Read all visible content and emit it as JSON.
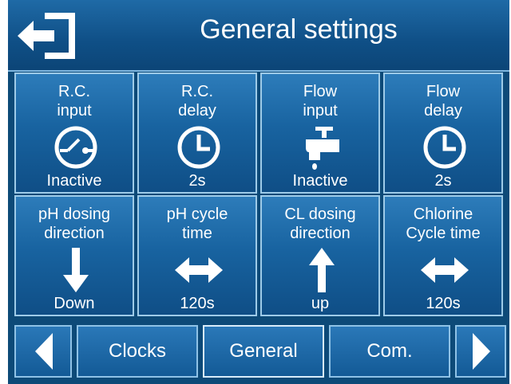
{
  "header": {
    "title": "General settings",
    "back_icon": "exit-arrow-icon"
  },
  "tiles": [
    {
      "label": "R.C.\ninput",
      "value": "Inactive",
      "icon": "switch-icon"
    },
    {
      "label": "R.C.\ndelay",
      "value": "2s",
      "icon": "clock-icon"
    },
    {
      "label": "Flow\ninput",
      "value": "Inactive",
      "icon": "faucet-icon"
    },
    {
      "label": "Flow\ndelay",
      "value": "2s",
      "icon": "clock-icon"
    },
    {
      "label": "pH dosing\ndirection",
      "value": "Down",
      "icon": "arrow-down-icon"
    },
    {
      "label": "pH cycle\ntime",
      "value": "120s",
      "icon": "double-arrow-icon"
    },
    {
      "label": "CL dosing\ndirection",
      "value": "up",
      "icon": "arrow-up-icon"
    },
    {
      "label": "Chlorine\nCycle time",
      "value": "120s",
      "icon": "double-arrow-icon"
    }
  ],
  "footer": {
    "prev_icon": "triangle-left-icon",
    "next_icon": "triangle-right-icon",
    "tabs": [
      {
        "label": "Clocks"
      },
      {
        "label": "General",
        "active": true
      },
      {
        "label": "Com."
      }
    ]
  },
  "colors": {
    "background": "#0d4a78",
    "tile": "#1863a0",
    "border": "#9ecbe8",
    "text": "#ffffff"
  }
}
